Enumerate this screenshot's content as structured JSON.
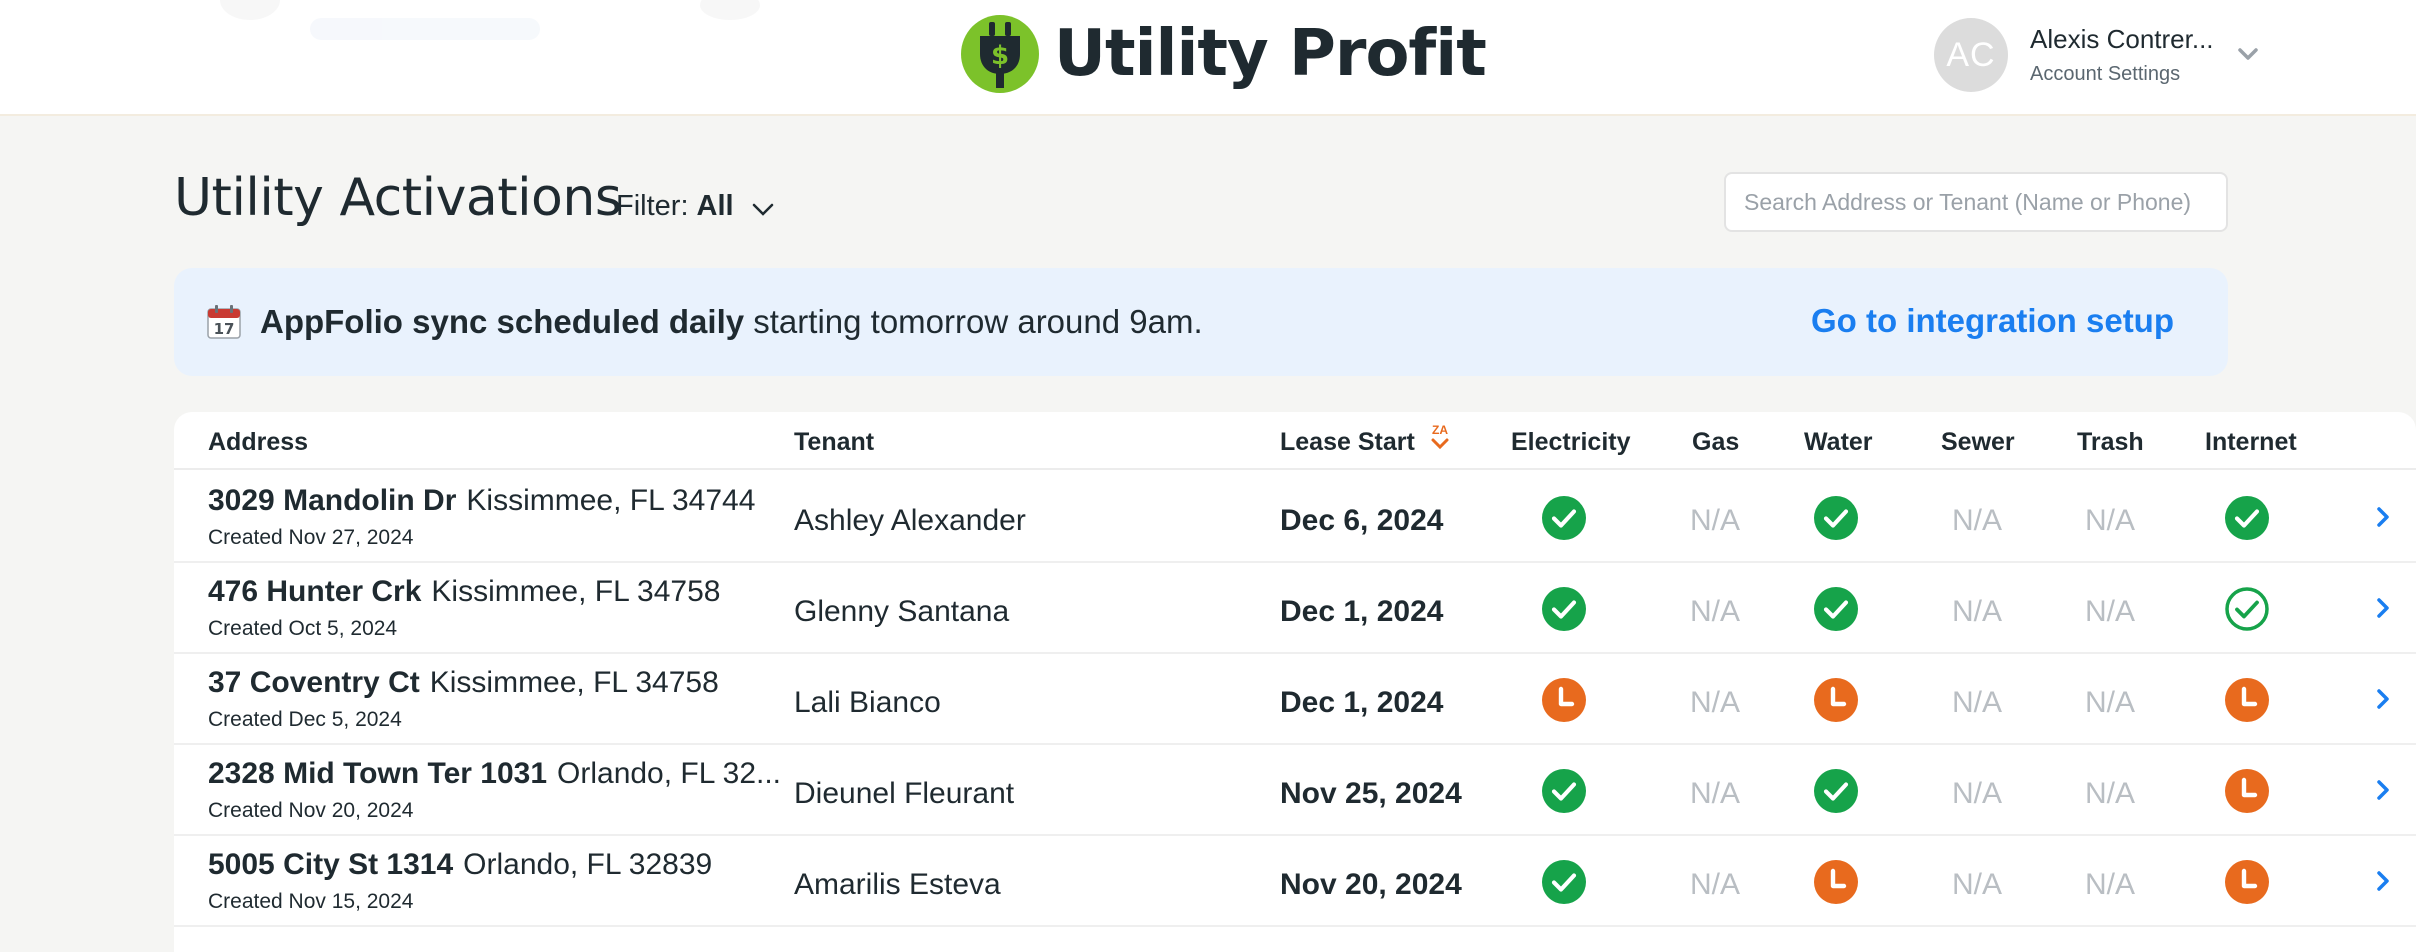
{
  "app": {
    "name": "Utility Profit"
  },
  "account": {
    "initials": "AC",
    "name": "Alexis Contrer...",
    "settings_label": "Account Settings"
  },
  "page": {
    "title": "Utility Activations",
    "filter_label": "Filter:",
    "filter_value": "All",
    "search_placeholder": "Search Address or Tenant (Name or Phone)"
  },
  "banner": {
    "bold_text": "AppFolio sync scheduled daily",
    "text": " starting tomorrow around 9am.",
    "link": "Go to integration setup"
  },
  "table": {
    "columns": {
      "address": "Address",
      "tenant": "Tenant",
      "lease_start": "Lease Start",
      "sort_indicator": "ZA",
      "electricity": "Electricity",
      "gas": "Gas",
      "water": "Water",
      "sewer": "Sewer",
      "trash": "Trash",
      "internet": "Internet"
    },
    "na_text": "N/A",
    "rows": [
      {
        "street": "3029 Mandolin Dr",
        "city": "Kissimmee, FL 34744",
        "created": "Created Nov 27, 2024",
        "tenant": "Ashley Alexander",
        "lease_start": "Dec 6, 2024",
        "electricity": "active",
        "gas": "na",
        "water": "active",
        "sewer": "na",
        "trash": "na",
        "internet": "active"
      },
      {
        "street": "476 Hunter Crk",
        "city": "Kissimmee, FL 34758",
        "created": "Created Oct 5, 2024",
        "tenant": "Glenny Santana",
        "lease_start": "Dec 1, 2024",
        "electricity": "active",
        "gas": "na",
        "water": "active",
        "sewer": "na",
        "trash": "na",
        "internet": "active-outline"
      },
      {
        "street": "37 Coventry Ct",
        "city": "Kissimmee, FL 34758",
        "created": "Created Dec 5, 2024",
        "tenant": "Lali Bianco",
        "lease_start": "Dec 1, 2024",
        "electricity": "pending",
        "gas": "na",
        "water": "pending",
        "sewer": "na",
        "trash": "na",
        "internet": "pending"
      },
      {
        "street": "2328 Mid Town Ter 1031",
        "city": "Orlando, FL 32...",
        "created": "Created Nov 20, 2024",
        "tenant": "Dieunel Fleurant",
        "lease_start": "Nov 25, 2024",
        "electricity": "active",
        "gas": "na",
        "water": "active",
        "sewer": "na",
        "trash": "na",
        "internet": "pending"
      },
      {
        "street": "5005 City St 1314",
        "city": "Orlando, FL 32839",
        "created": "Created Nov 15, 2024",
        "tenant": "Amarilis Esteva",
        "lease_start": "Nov 20, 2024",
        "electricity": "active",
        "gas": "na",
        "water": "pending",
        "sewer": "na",
        "trash": "na",
        "internet": "pending"
      }
    ]
  },
  "icons": {
    "logo": "plug-dollar-icon",
    "account_menu": "chevron-down-icon",
    "filter": "chevron-down-icon",
    "banner": "calendar-icon",
    "active": "check-circle-icon",
    "active_outline": "check-circle-outline-icon",
    "pending": "clock-icon",
    "row_open": "chevron-right-icon",
    "sort": "sort-desc-icon"
  },
  "colors": {
    "brand_green": "#7cc22a",
    "active_green": "#16a34a",
    "pending_orange": "#e86a1e",
    "link_blue": "#1a7ef0",
    "banner_bg": "#e9f2fd",
    "na_gray": "#b9bec3"
  }
}
